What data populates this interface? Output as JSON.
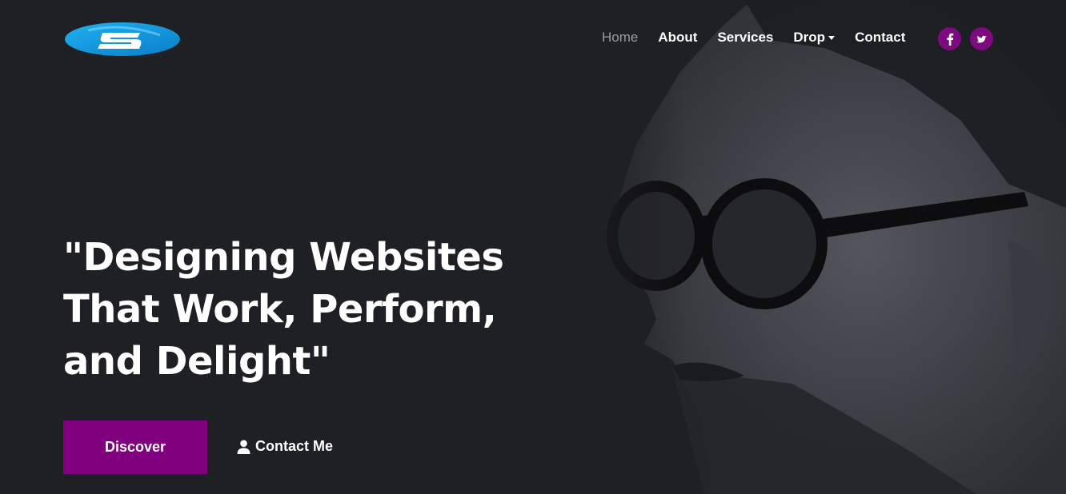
{
  "brand": {
    "logo_letter": "S",
    "logo_colors": [
      "#1fb1f0",
      "#0a7ec9"
    ]
  },
  "nav": {
    "items": [
      {
        "label": "Home",
        "active": true
      },
      {
        "label": "About"
      },
      {
        "label": "Services"
      },
      {
        "label": "Drop",
        "has_dropdown": true
      },
      {
        "label": "Contact"
      }
    ],
    "social": [
      {
        "icon": "facebook-icon"
      },
      {
        "icon": "twitter-icon"
      }
    ]
  },
  "hero": {
    "headline_lines": [
      "\"Designing Websites",
      "That Work, Perform,",
      "and Delight\""
    ],
    "primary_button": "Discover",
    "secondary_button": "Contact Me",
    "secondary_icon": "user-icon",
    "image": "portrait-photo"
  },
  "colors": {
    "background": "#1f2024",
    "accent": "#800080",
    "nav_active": "#9b9ba3"
  }
}
